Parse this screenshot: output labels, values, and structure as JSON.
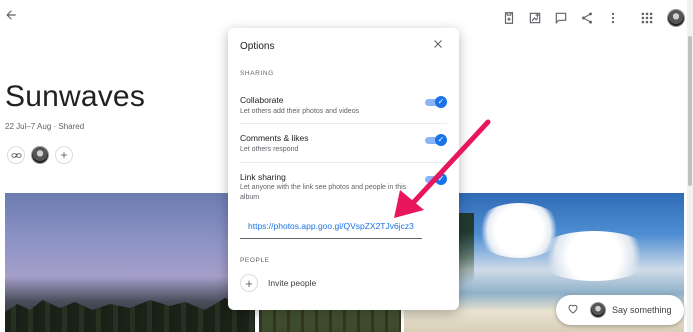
{
  "album": {
    "title": "Sunwaves",
    "subtitle": "22 Jul–7 Aug · Shared"
  },
  "options_dialog": {
    "title": "Options",
    "sharing_heading": "SHARING",
    "collaborate": {
      "title": "Collaborate",
      "description": "Let others add their photos and videos",
      "enabled": true
    },
    "comments_likes": {
      "title": "Comments & likes",
      "description": "Let others respond",
      "enabled": true
    },
    "link_sharing": {
      "title": "Link sharing",
      "description_line1": "Let anyone with the link see photos and people in this",
      "description_line2": "album",
      "enabled": true,
      "link": "https://photos.app.goo.gl/QVspZX2TJv6jcz3"
    },
    "people_heading": "PEOPLE",
    "invite_label": "Invite people"
  },
  "say_something": {
    "label": "Say something"
  },
  "icons": {
    "back": "arrow-back-icon",
    "close": "close-icon",
    "link": "link-icon",
    "add": "add-icon",
    "heart": "heart-icon",
    "toolbar": [
      "add-to-shared-icon",
      "add-photos-icon",
      "comment-icon",
      "share-icon",
      "more-vert-icon",
      "apps-grid-icon"
    ]
  },
  "colors": {
    "accent": "#1a73e8",
    "toggle_track": "#8ab4f8",
    "annotation_arrow": "#e8175d"
  }
}
